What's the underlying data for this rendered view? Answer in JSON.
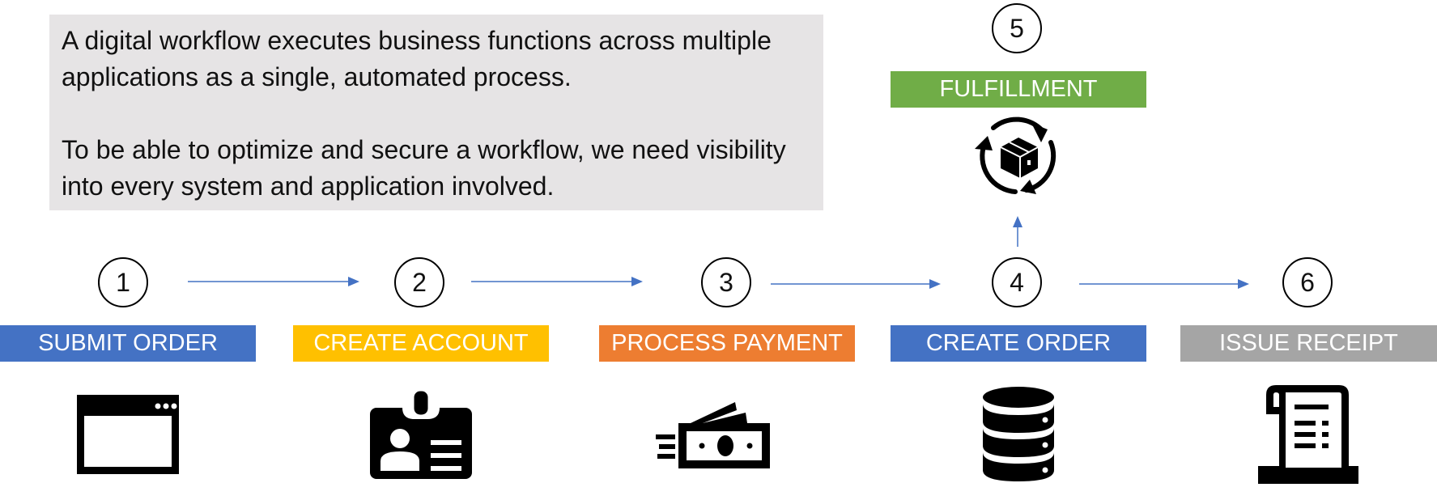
{
  "intro": {
    "paragraphs": [
      "A digital workflow executes business functions across multiple applications as a single, automated process.",
      "To be able to optimize and secure a workflow, we need visibility into every system and application involved."
    ]
  },
  "colors": {
    "blue": "#4472c4",
    "yellow": "#ffc000",
    "orange": "#ed7d31",
    "green": "#70ad47",
    "gray": "#a5a5a5",
    "arrow": "#4472c4",
    "intro_bg": "#e6e4e5"
  },
  "steps": [
    {
      "number": "1",
      "label": "SUBMIT ORDER",
      "color": "blue",
      "icon": "browser-window-icon"
    },
    {
      "number": "2",
      "label": "CREATE ACCOUNT",
      "color": "yellow",
      "icon": "id-badge-icon"
    },
    {
      "number": "3",
      "label": "PROCESS PAYMENT",
      "color": "orange",
      "icon": "money-icon"
    },
    {
      "number": "4",
      "label": "CREATE ORDER",
      "color": "blue",
      "icon": "database-icon"
    },
    {
      "number": "5",
      "label": "FULFILLMENT",
      "color": "green",
      "icon": "package-cycle-icon"
    },
    {
      "number": "6",
      "label": "ISSUE RECEIPT",
      "color": "gray",
      "icon": "receipt-icon"
    }
  ],
  "flow": [
    {
      "from": "1",
      "to": "2"
    },
    {
      "from": "2",
      "to": "3"
    },
    {
      "from": "3",
      "to": "4"
    },
    {
      "from": "4",
      "to": "6"
    },
    {
      "from": "4",
      "to": "5"
    }
  ]
}
